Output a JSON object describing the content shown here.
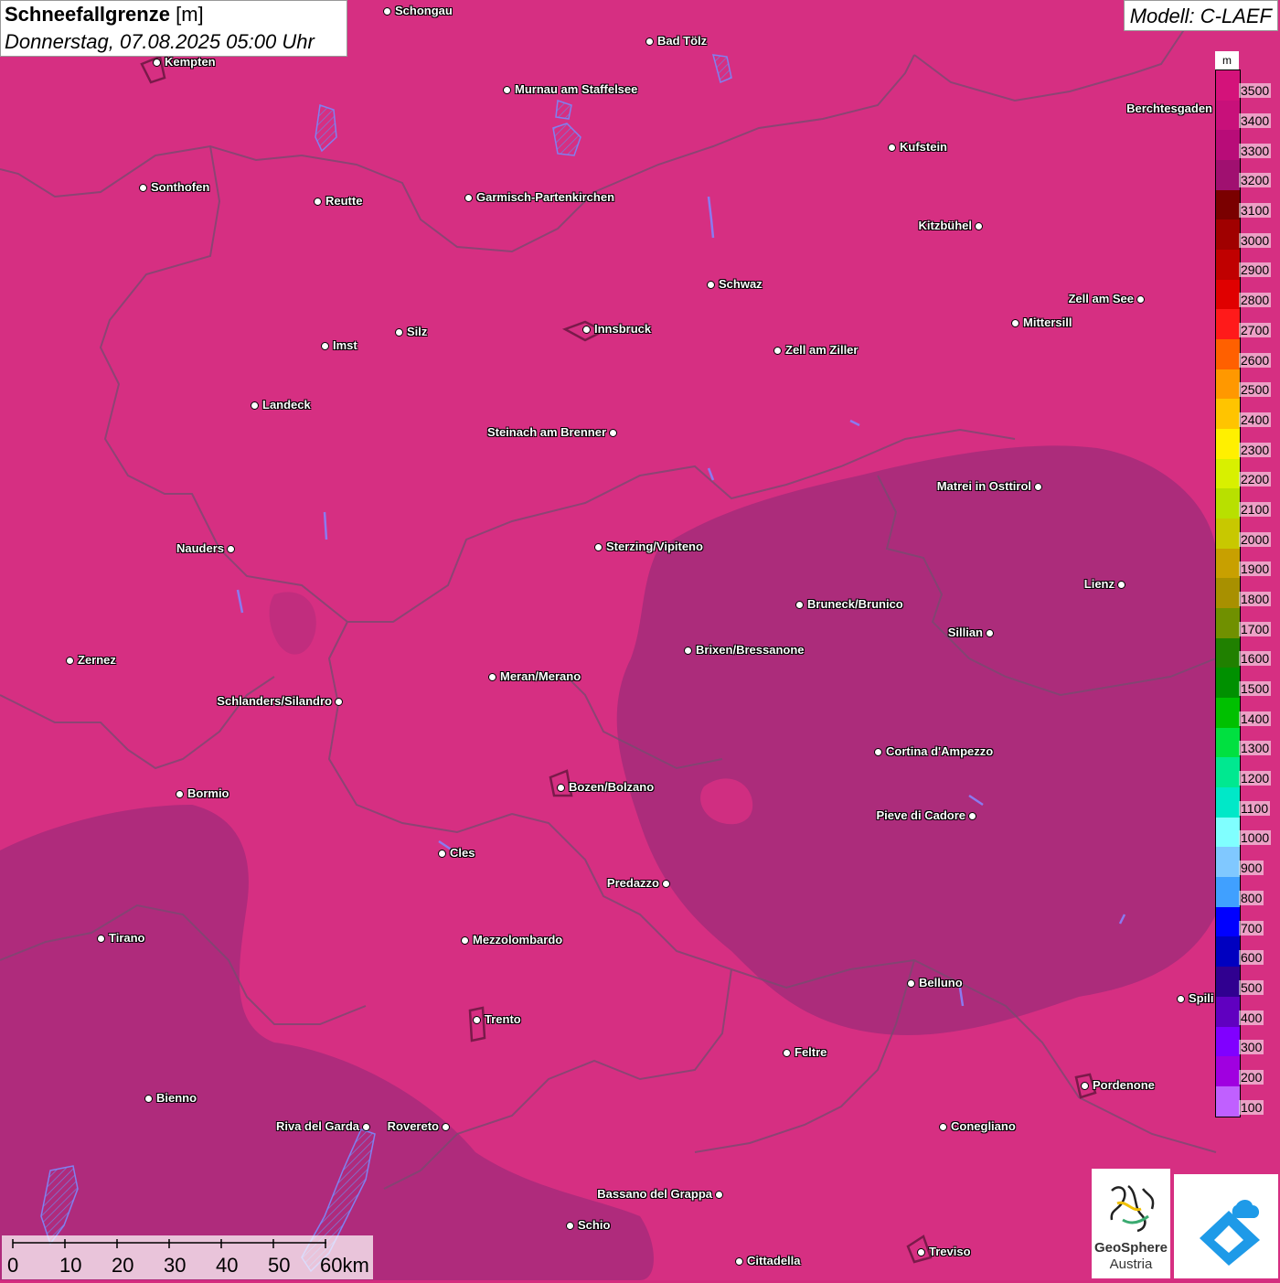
{
  "header": {
    "title_bold": "Schneefallgrenze",
    "title_unit": "[m]",
    "datetime": "Donnerstag, 07.08.2025 05:00 Uhr"
  },
  "model_label": "Modell: C-LAEF",
  "legend": {
    "unit": "m",
    "levels": [
      "3500",
      "3400",
      "3300",
      "3200",
      "3100",
      "3000",
      "2900",
      "2800",
      "2700",
      "2600",
      "2500",
      "2400",
      "2300",
      "2200",
      "2100",
      "2000",
      "1900",
      "1800",
      "1700",
      "1600",
      "1500",
      "1400",
      "1300",
      "1200",
      "1100",
      "1000",
      "900",
      "800",
      "700",
      "600",
      "500",
      "400",
      "300",
      "200",
      "100"
    ],
    "colors": [
      "#d4127a",
      "#c8107a",
      "#b80c78",
      "#a01070",
      "#7a0000",
      "#a00000",
      "#c00000",
      "#e00000",
      "#ff1a1a",
      "#ff6000",
      "#ff9800",
      "#ffc400",
      "#fff000",
      "#d8f000",
      "#b8e000",
      "#c8c800",
      "#c8a000",
      "#a89000",
      "#709000",
      "#208000",
      "#009000",
      "#00c000",
      "#00e040",
      "#00e890",
      "#00e8c8",
      "#80ffff",
      "#80c8ff",
      "#40a0ff",
      "#0000ff",
      "#0000c0",
      "#300090",
      "#6000c0",
      "#8000ff",
      "#a000e0",
      "#c060ff"
    ]
  },
  "cities": [
    {
      "name": "Schongau"
    },
    {
      "name": "Bad Tölz"
    },
    {
      "name": "Kempten"
    },
    {
      "name": "Murnau am Staffelsee"
    },
    {
      "name": "Berchtesgaden"
    },
    {
      "name": "Kufstein"
    },
    {
      "name": "Sonthofen"
    },
    {
      "name": "Reutte"
    },
    {
      "name": "Garmisch-Partenkirchen"
    },
    {
      "name": "Kitzbühel"
    },
    {
      "name": "Schwaz"
    },
    {
      "name": "Zell am See"
    },
    {
      "name": "Mittersill"
    },
    {
      "name": "Innsbruck"
    },
    {
      "name": "Silz"
    },
    {
      "name": "Imst"
    },
    {
      "name": "Zell am Ziller"
    },
    {
      "name": "Landeck"
    },
    {
      "name": "Steinach am Brenner"
    },
    {
      "name": "Matrei in Osttirol"
    },
    {
      "name": "Nauders"
    },
    {
      "name": "Sterzing/Vipiteno"
    },
    {
      "name": "Lienz"
    },
    {
      "name": "Bruneck/Brunico"
    },
    {
      "name": "Sillian"
    },
    {
      "name": "Zernez"
    },
    {
      "name": "Brixen/Bressanone"
    },
    {
      "name": "Meran/Merano"
    },
    {
      "name": "Schlanders/Silandro"
    },
    {
      "name": "Cortina d'Ampezzo"
    },
    {
      "name": "Bormio"
    },
    {
      "name": "Bozen/Bolzano"
    },
    {
      "name": "Pieve di Cadore"
    },
    {
      "name": "Cles"
    },
    {
      "name": "Predazzo"
    },
    {
      "name": "Tirano"
    },
    {
      "name": "Mezzolombardo"
    },
    {
      "name": "Belluno"
    },
    {
      "name": "Spili"
    },
    {
      "name": "Trento"
    },
    {
      "name": "Feltre"
    },
    {
      "name": "Pordenone"
    },
    {
      "name": "Bienno"
    },
    {
      "name": "Riva del Garda"
    },
    {
      "name": "Rovereto"
    },
    {
      "name": "Conegliano"
    },
    {
      "name": "Bassano del Grappa"
    },
    {
      "name": "Schio"
    },
    {
      "name": "Treviso"
    },
    {
      "name": "Cittadella"
    }
  ],
  "scalebar": {
    "labels": [
      "0",
      "10",
      "20",
      "30",
      "40",
      "50",
      "60km"
    ]
  },
  "logo": {
    "line1": "GeoSphere",
    "line2": "Austria"
  }
}
